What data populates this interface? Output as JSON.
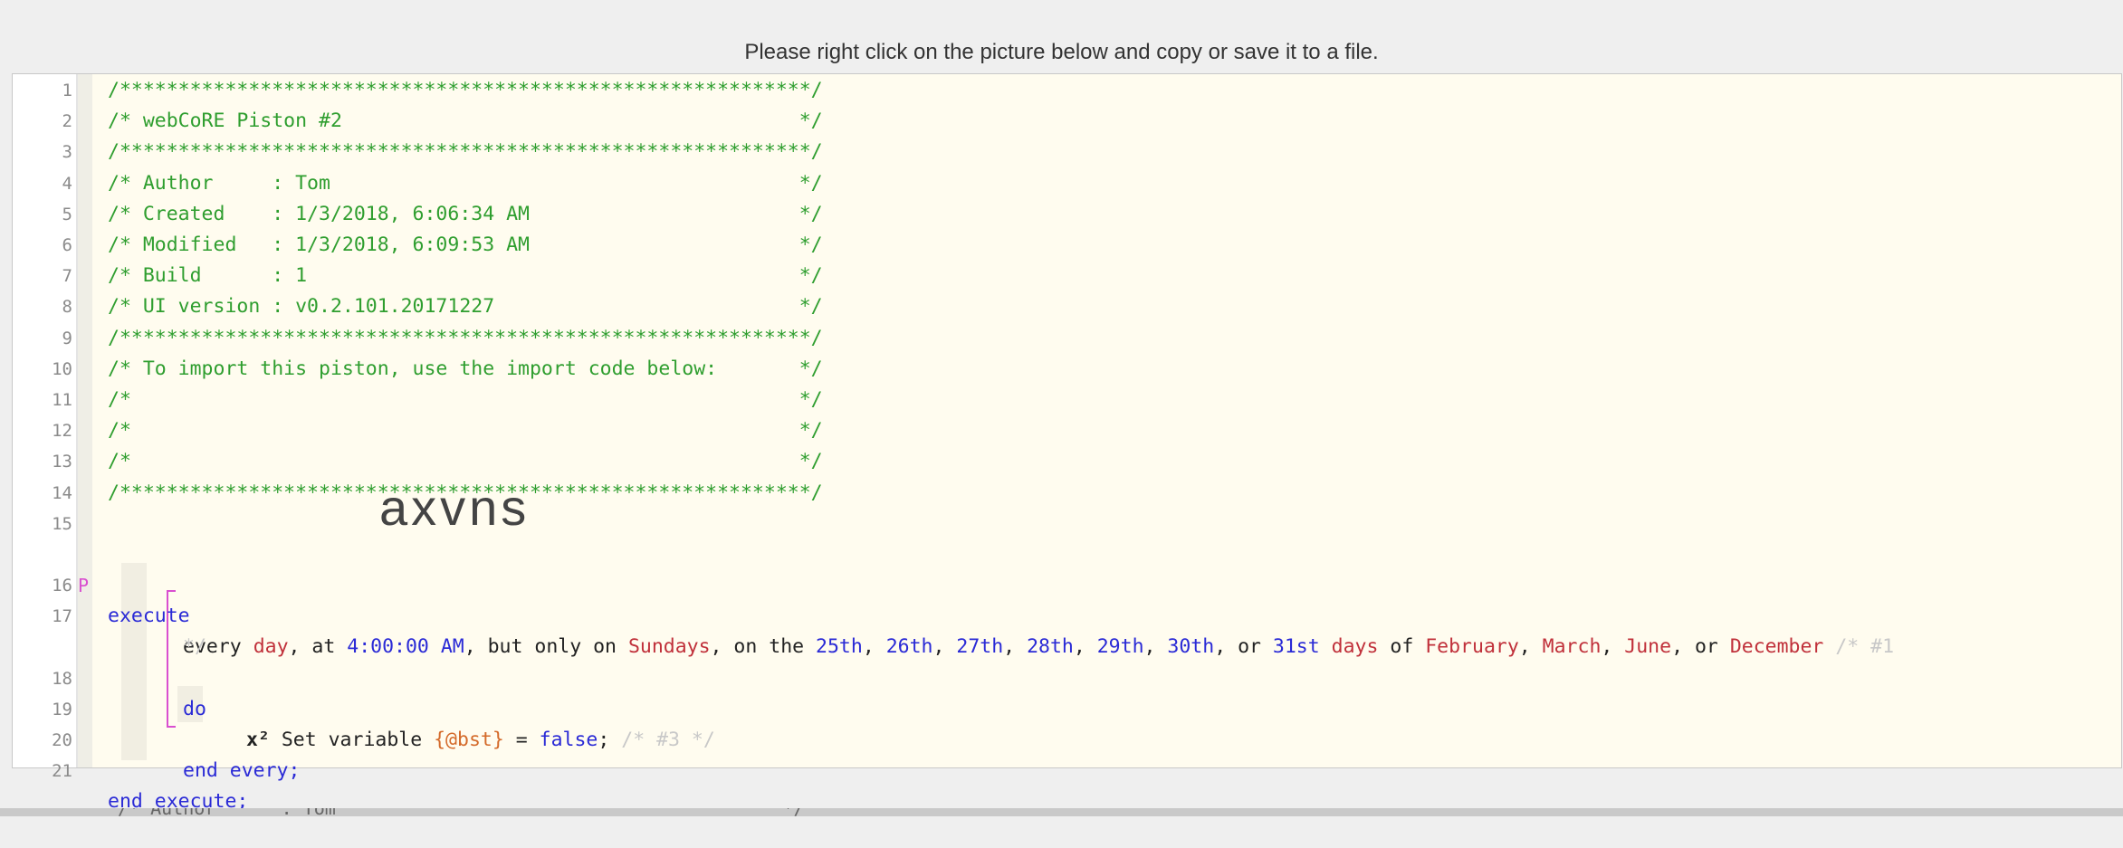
{
  "instruction": "Please right click on the picture below and copy or save it to a file.",
  "header_lines": [
    {
      "n": "1",
      "text": "/***********************************************************/"
    },
    {
      "n": "2",
      "text": "/* webCoRE Piston #2                                       */"
    },
    {
      "n": "3",
      "text": "/***********************************************************/"
    },
    {
      "n": "4",
      "text": "/* Author     : Tom                                        */"
    },
    {
      "n": "5",
      "text": "/* Created    : 1/3/2018, 6:06:34 AM                       */"
    },
    {
      "n": "6",
      "text": "/* Modified   : 1/3/2018, 6:09:53 AM                       */"
    },
    {
      "n": "7",
      "text": "/* Build      : 1                                          */"
    },
    {
      "n": "8",
      "text": "/* UI version : v0.2.101.20171227                          */"
    },
    {
      "n": "9",
      "text": "/***********************************************************/"
    },
    {
      "n": "10",
      "text": "/* To import this piston, use the import code below:       */"
    },
    {
      "n": "11",
      "text": "/*                                                         */"
    },
    {
      "n": "12",
      "text": "/*                                                         */"
    },
    {
      "n": "13",
      "text": "/*                                                         */"
    },
    {
      "n": "14",
      "text": "/***********************************************************/"
    }
  ],
  "import_code": "axvns",
  "line15": "15",
  "line16": {
    "n": "16",
    "kw": "execute"
  },
  "line17": {
    "n": "17",
    "marker": "P",
    "every": "every",
    "day": "day",
    "at": ", at ",
    "time": "4:00:00 AM",
    "but_only_on": ", but only on ",
    "sundays": "Sundays",
    "on_the": ", on the ",
    "d25": "25th",
    "d26": "26th",
    "d27": "27th",
    "d28": "28th",
    "d29": "29th",
    "d30": "30th",
    "d31": "31st",
    "comma": ", ",
    "or": ", or ",
    "days": "days",
    "of": " of ",
    "feb": "February",
    "mar": "March",
    "jun": "June",
    "dec": "December",
    "cmt_a": " /* #1",
    "cmt_b": "*/"
  },
  "line18": {
    "n": "18",
    "kw": "do"
  },
  "line19": {
    "n": "19",
    "icon": "x²",
    "set_variable": " Set variable ",
    "var": "{@bst}",
    "eq": " = ",
    "val": "false",
    "semi": ";",
    "cmt": " /* #3 */"
  },
  "line20": {
    "n": "20",
    "kw": "end every;"
  },
  "line21": {
    "n": "21",
    "kw": "end execute;"
  },
  "footer_peek": "/* Author      : Tom                                         */"
}
